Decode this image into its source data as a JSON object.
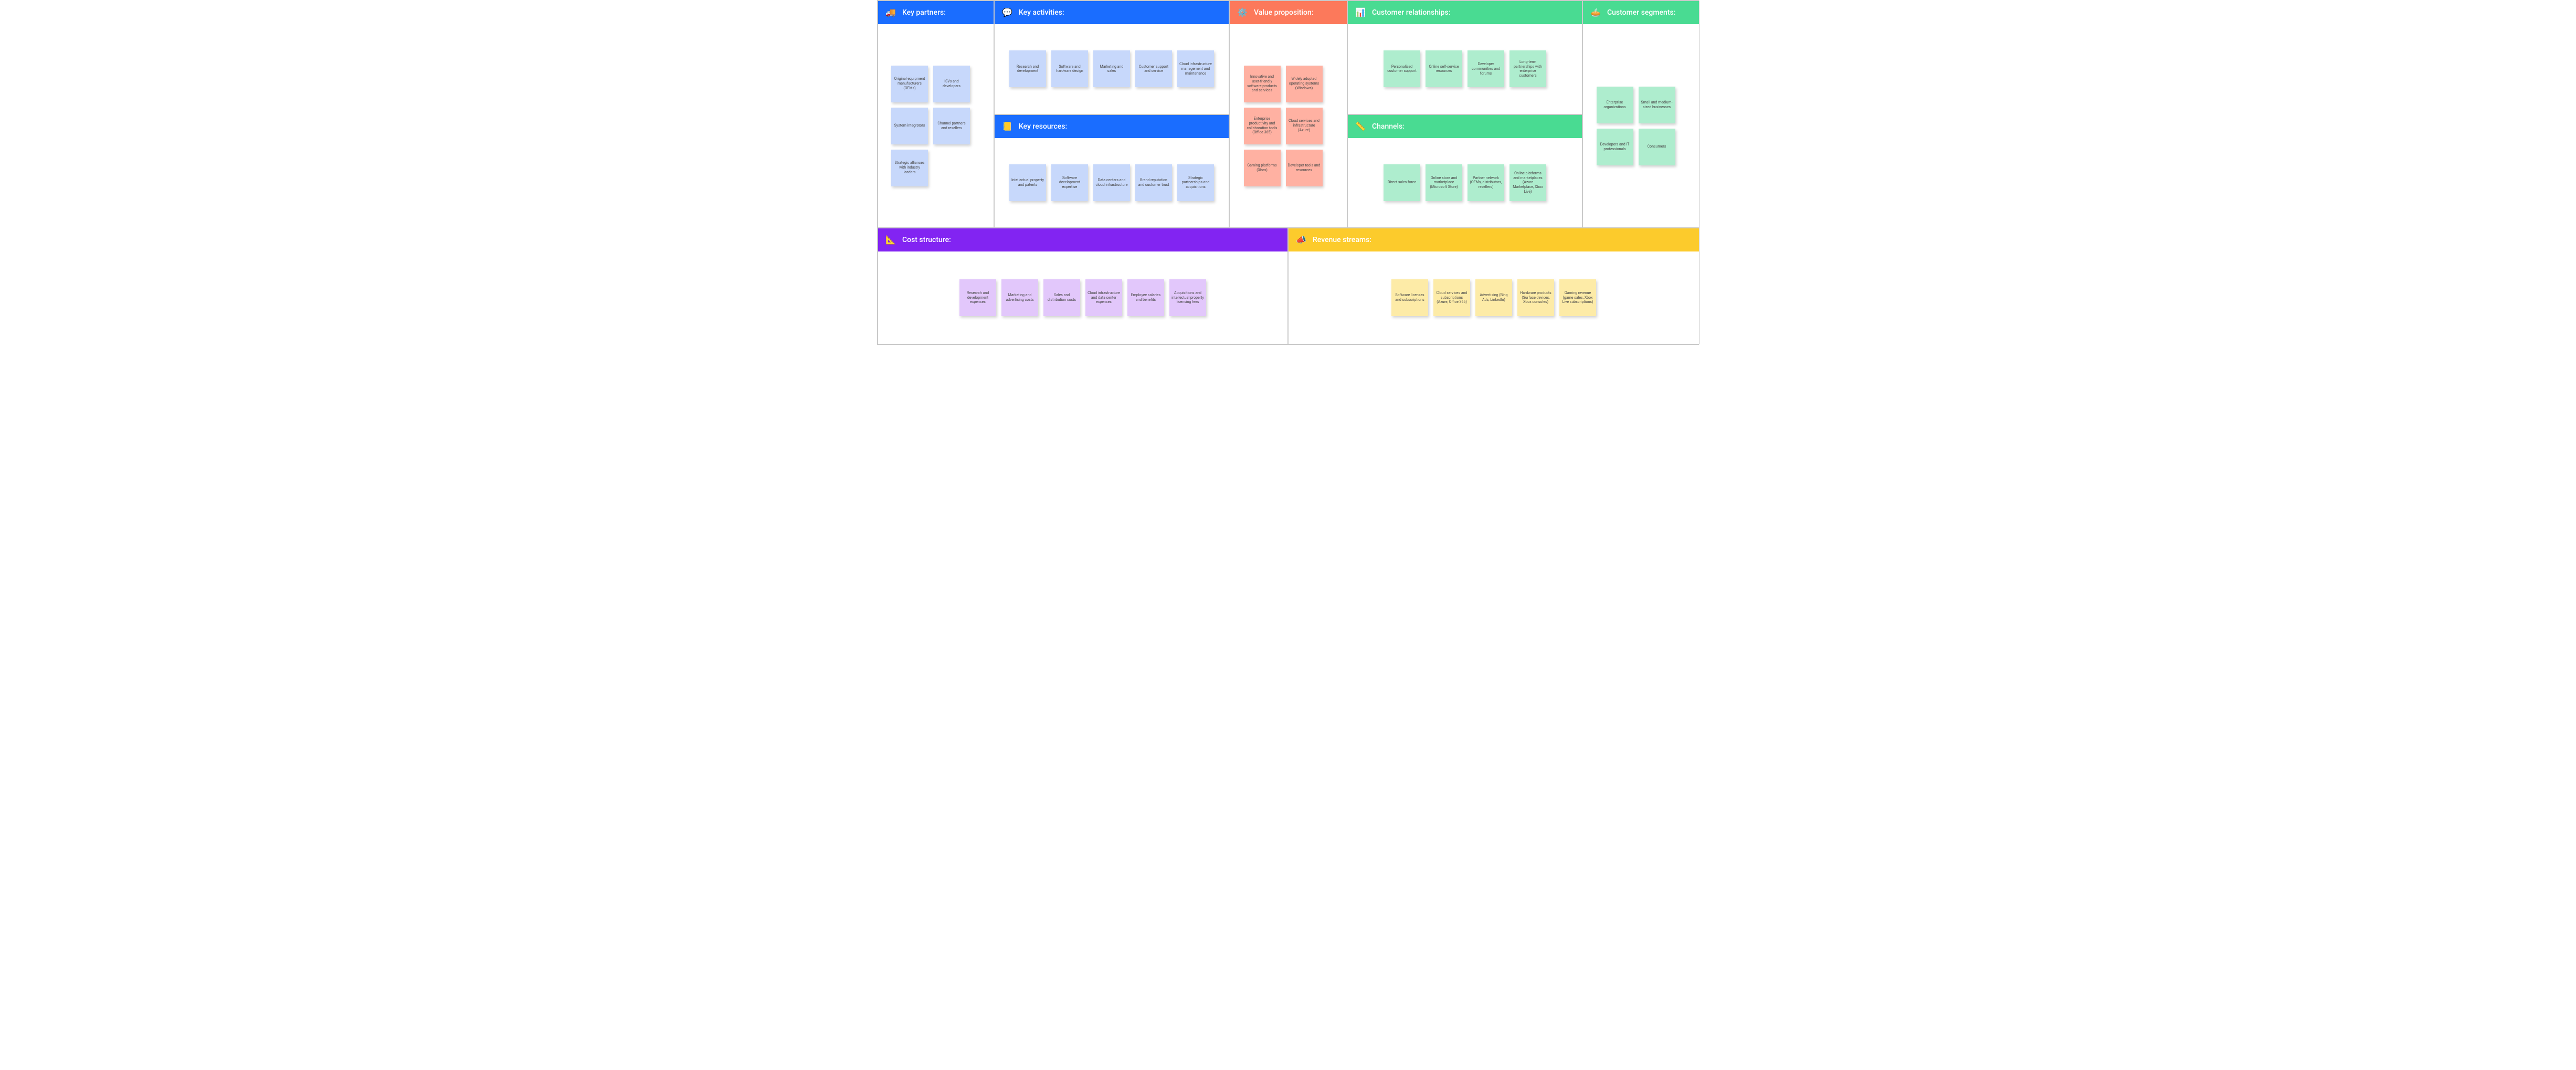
{
  "blocks": {
    "key_partners": {
      "title": "Key partners:",
      "icon": "🚚",
      "notes": [
        "Original equipment manufacturers (OEMs)",
        "ISVs and developers",
        "System integrators",
        "Channel partners and resellers",
        "Strategic alliances with industry leaders"
      ]
    },
    "key_activities": {
      "title": "Key activities:",
      "icon": "💬",
      "notes": [
        "Research and development",
        "Software and hardware design",
        "Marketing and sales",
        "Customer support and service",
        "Cloud infrastructure management and maintenance"
      ]
    },
    "key_resources": {
      "title": "Key resources:",
      "icon": "📒",
      "notes": [
        "Intellectual property and patents",
        "Software development expertise",
        "Data centers and cloud infrastructure",
        "Brand reputation and customer trust",
        "Strategic partnerships and acquisitions"
      ]
    },
    "value_proposition": {
      "title": "Value proposition:",
      "icon": "⚙️",
      "notes": [
        "Innovative and user-friendly software products and services",
        "Widely adopted operating systems (Windows)",
        "Enterprise productivity and collaboration tools (Office 365)",
        "Cloud services and infrastructure (Azure)",
        "Gaming platforms (Xbox)",
        "Developer tools and resources"
      ]
    },
    "customer_relationships": {
      "title": "Customer relationships:",
      "icon": "📊",
      "notes": [
        "Personalized customer support",
        "Online self-service resources",
        "Developer communities and forums",
        "Long-term partnerships with enterprise customers"
      ]
    },
    "channels": {
      "title": "Channels:",
      "icon": "📏",
      "notes": [
        "Direct sales force",
        "Online store and marketplace (Microsoft Store)",
        "Partner network (OEMs, distributors, resellers)",
        "Online platforms and marketplaces (Azure Marketplace, Xbox Live)"
      ]
    },
    "customer_segments": {
      "title": "Customer segments:",
      "icon": "🥧",
      "notes": [
        "Enterprise organizations",
        "Small and medium-sized businesses",
        "Developers and IT professionals",
        "Consumers"
      ]
    },
    "cost_structure": {
      "title": "Cost structure:",
      "icon": "📐",
      "notes": [
        "Research and development expenses",
        "Marketing and advertising costs",
        "Sales and distribution costs",
        "Cloud infrastructure and data center expenses",
        "Employee salaries and benefits",
        "Acquisitions and intellectual property licensing fees"
      ]
    },
    "revenue_streams": {
      "title": "Revenue streams:",
      "icon": "📣",
      "notes": [
        "Software licenses and subscriptions",
        "Cloud services and subscriptions (Azure, Office 365)",
        "Advertising (Bing Ads, LinkedIn)",
        "Hardware products (Surface devices, Xbox consoles)",
        "Gaming revenue (game sales, Xbox Live subscriptions)"
      ]
    }
  }
}
